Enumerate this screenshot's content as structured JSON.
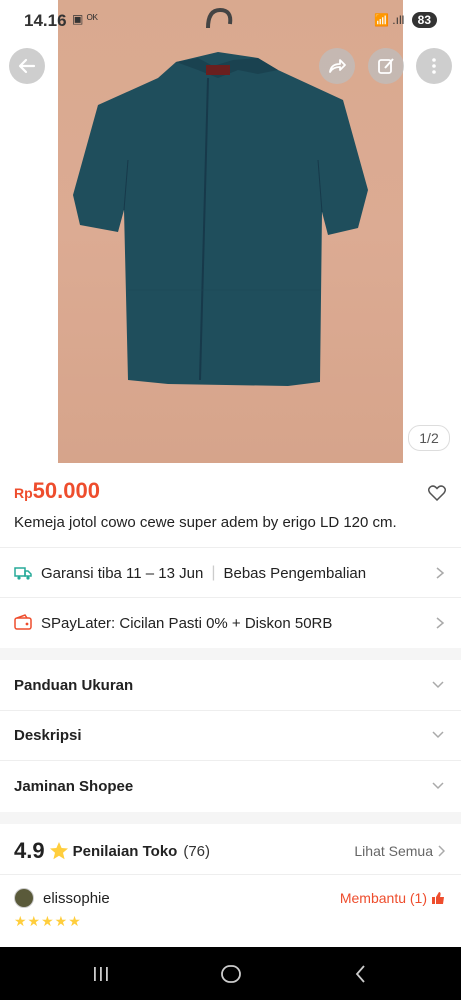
{
  "status_bar": {
    "time": "14.16",
    "left_icons": "▣ ᴼᴷ",
    "signal": "📶 .ıll",
    "battery": "83"
  },
  "gallery": {
    "counter": "1/2"
  },
  "product": {
    "currency": "Rp",
    "price": "50.000",
    "title": "Kemeja jotol cowo cewe super adem by erigo LD 120 cm."
  },
  "shipping": {
    "guarantee": "Garansi tiba 11 – 13 Jun",
    "returns": "Bebas Pengembalian"
  },
  "paylater": {
    "text": "SPayLater: Cicilan Pasti 0% + Diskon 50RB"
  },
  "sections": [
    "Panduan Ukuran",
    "Deskripsi",
    "Jaminan Shopee"
  ],
  "shop_rating": {
    "score": "4.9",
    "label": "Penilaian Toko",
    "count": "(76)",
    "see_all": "Lihat Semua"
  },
  "review": {
    "username": "elissophie",
    "helpful": "Membantu (1)",
    "stars": "★★★★★"
  },
  "colors": {
    "accent": "#ee4d2d",
    "star": "#ffce3d",
    "shipping_icon": "#26aa99"
  }
}
